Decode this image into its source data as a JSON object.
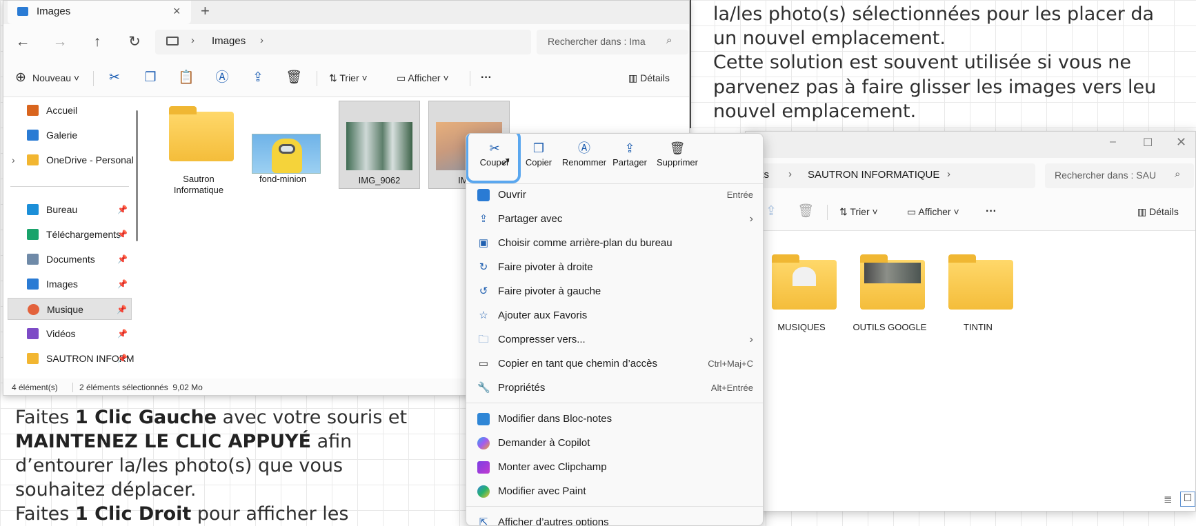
{
  "instructions_left": {
    "line1_pre": "Faites ",
    "line1_bold": "1 Clic Gauche",
    "line1_post": " avec votre souris et",
    "line2_bold": "MAINTENEZ LE CLIC APPUYÉ",
    "line2_post": " afin",
    "line3": "d’entourer la/les photo(s) que vous",
    "line4": "souhaitez déplacer.",
    "line5_pre": "Faites ",
    "line5_bold": "1 Clic Droit",
    "line5_post": " pour afficher les"
  },
  "instructions_right": {
    "line1": "la/les photo(s) sélectionnées pour les placer da",
    "line2": "un nouvel emplacement.",
    "line3": "Cette solution est souvent utilisée si vous ne",
    "line4": "parvenez pas à faire glisser les images vers leu",
    "line5": "nouvel emplacement."
  },
  "explorer_left": {
    "tab_title": "Images",
    "tab_close": "×",
    "tab_add": "+",
    "breadcrumb": [
      "Images"
    ],
    "search_placeholder": "Rechercher dans : Ima",
    "toolbar": {
      "new": "Nouveau",
      "sort": "Trier",
      "view": "Afficher",
      "more": "···",
      "details": "Détails"
    },
    "sidebar": [
      {
        "label": "Accueil",
        "color": "#d9651e",
        "pinned": false
      },
      {
        "label": "Galerie",
        "color": "#2a7bd4",
        "pinned": false
      },
      {
        "label": "OneDrive - Personal",
        "color": "#f2b631",
        "pinned": false,
        "expand": "›"
      },
      {
        "label": "Bureau",
        "color": "#1c8fd8",
        "pinned": true
      },
      {
        "label": "Téléchargements",
        "color": "#1aa36b",
        "pinned": true
      },
      {
        "label": "Documents",
        "color": "#6f8aa8",
        "pinned": true
      },
      {
        "label": "Images",
        "color": "#2a7bd4",
        "pinned": true
      },
      {
        "label": "Musique",
        "color": "#e3623c",
        "pinned": true,
        "selected": true
      },
      {
        "label": "Vidéos",
        "color": "#7d4bc6",
        "pinned": true
      },
      {
        "label": "SAUTRON INFORM",
        "color": "#f2b631",
        "pinned": true
      }
    ],
    "files": [
      {
        "label": "Sautron Informatique",
        "type": "folder"
      },
      {
        "label": "fond-minion",
        "type": "image"
      },
      {
        "label": "IMG_9062",
        "type": "image",
        "selected": true
      },
      {
        "label": "IMG_",
        "type": "image",
        "selected": true
      }
    ],
    "status": {
      "count": "4 élément(s)",
      "selection": "2 éléments sélectionnés  9,02 Mo"
    }
  },
  "explorer_right": {
    "breadcrumb": [
      "nts",
      "SAUTRON INFORMATIQUE"
    ],
    "search_placeholder": "Rechercher dans : SAU",
    "toolbar": {
      "sort": "Trier",
      "view": "Afficher",
      "more": "···",
      "details": "Détails"
    },
    "folders": [
      {
        "label": "MUSIQUES"
      },
      {
        "label": "OUTILS GOOGLE"
      },
      {
        "label": "TINTIN"
      }
    ]
  },
  "context_menu": {
    "quick_actions": [
      {
        "label": "Couper",
        "icon": "cut-icon",
        "highlighted": true
      },
      {
        "label": "Copier",
        "icon": "copy-icon"
      },
      {
        "label": "Renommer",
        "icon": "rename-icon"
      },
      {
        "label": "Partager",
        "icon": "share-icon"
      },
      {
        "label": "Supprimer",
        "icon": "delete-icon"
      }
    ],
    "items": [
      {
        "label": "Ouvrir",
        "shortcut": "Entrée",
        "icon": "open-icon"
      },
      {
        "label": "Partager avec",
        "submenu": true,
        "icon": "share-icon"
      },
      {
        "label": "Choisir comme arrière-plan du bureau",
        "icon": "desktop-icon"
      },
      {
        "label": "Faire pivoter à droite",
        "icon": "rotate-right-icon"
      },
      {
        "label": "Faire pivoter à gauche",
        "icon": "rotate-left-icon"
      },
      {
        "label": "Ajouter aux Favoris",
        "icon": "star-icon"
      },
      {
        "label": "Compresser vers...",
        "submenu": true,
        "icon": "zip-icon"
      },
      {
        "label": "Copier en tant que chemin d’accès",
        "shortcut": "Ctrl+Maj+C",
        "icon": "path-icon"
      },
      {
        "label": "Propriétés",
        "shortcut": "Alt+Entrée",
        "icon": "properties-icon"
      },
      {
        "label": "Modifier dans Bloc-notes",
        "icon": "notepad-icon"
      },
      {
        "label": "Demander à Copilot",
        "icon": "copilot-icon"
      },
      {
        "label": "Monter avec Clipchamp",
        "icon": "clipchamp-icon"
      },
      {
        "label": "Modifier avec Paint",
        "icon": "paint-icon"
      },
      {
        "label": "Afficher d’autres options",
        "icon": "more-options-icon"
      }
    ]
  },
  "colors": {
    "accent": "#1f5fb0",
    "highlight_ring": "#5aa7ef",
    "folder": "#f4bd3a"
  }
}
